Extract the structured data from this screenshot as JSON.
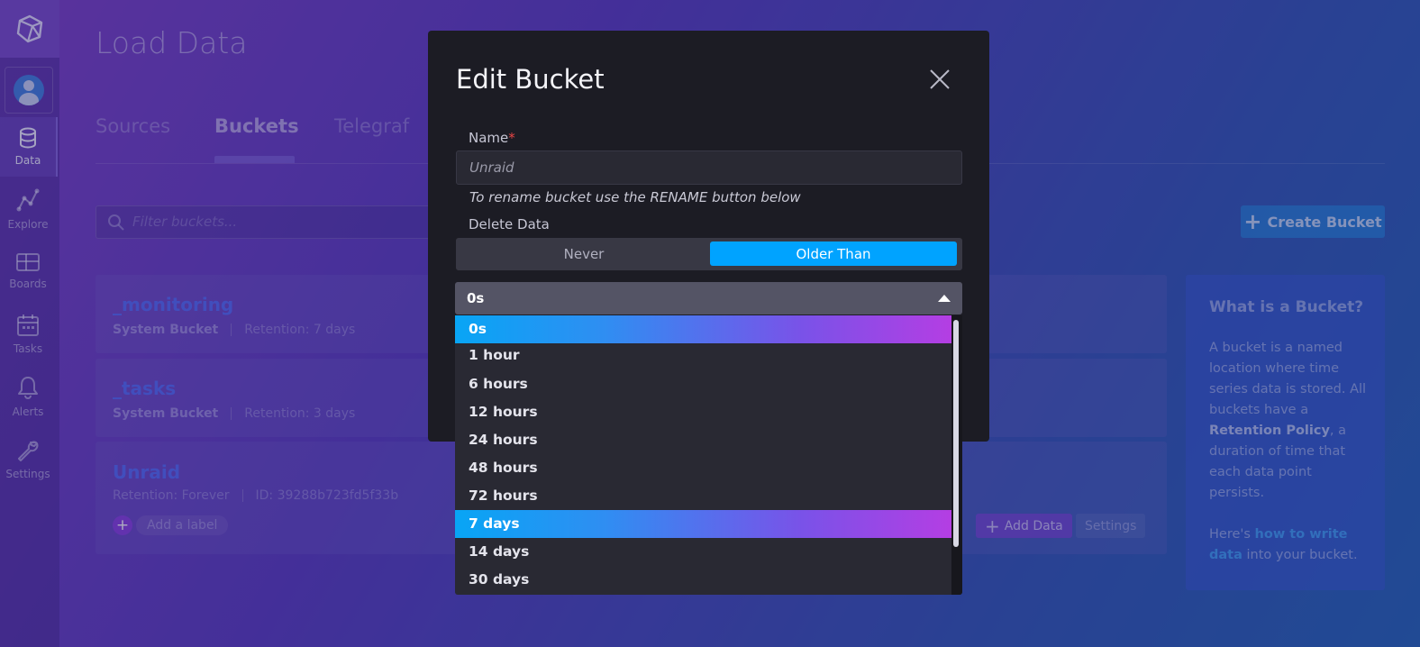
{
  "sidebar": {
    "items": [
      {
        "label": "Data",
        "icon": "database-icon"
      },
      {
        "label": "Explore",
        "icon": "graph-icon"
      },
      {
        "label": "Boards",
        "icon": "dashboard-icon"
      },
      {
        "label": "Tasks",
        "icon": "calendar-icon"
      },
      {
        "label": "Alerts",
        "icon": "bell-icon"
      },
      {
        "label": "Settings",
        "icon": "wrench-icon"
      }
    ]
  },
  "page": {
    "title": "Load Data",
    "tabs": [
      "Sources",
      "Buckets",
      "Telegraf"
    ],
    "active_tab": "Buckets",
    "filter_placeholder": "Filter buckets...",
    "create_button": "Create Bucket"
  },
  "buckets": [
    {
      "name": "_monitoring",
      "type": "System Bucket",
      "retention": "Retention: 7 days"
    },
    {
      "name": "_tasks",
      "type": "System Bucket",
      "retention": "Retention: 3 days"
    },
    {
      "name": "Unraid",
      "retention": "Retention: Forever",
      "id": "ID: 39288b723fd5f33b",
      "add_label": "Add a label",
      "add_data": "Add Data",
      "settings": "Settings"
    }
  ],
  "info_panel": {
    "title": "What is a Bucket?",
    "p1_a": "A bucket is a named location where time series data is stored. All buckets have a ",
    "p1_bold": "Retention Policy",
    "p1_b": ", a duration of time that each data point persists.",
    "p2_a": "Here's ",
    "p2_link": "how to write data",
    "p2_b": " into your bucket."
  },
  "modal": {
    "title": "Edit Bucket",
    "name_label": "Name",
    "required_mark": "*",
    "name_value": "Unraid",
    "rename_hint": "To rename bucket use the RENAME button below",
    "delete_label": "Delete Data",
    "toggle_never": "Never",
    "toggle_older": "Older Than",
    "toggle_selected": "Older Than",
    "dropdown_value": "0s",
    "options": [
      "0s",
      "1 hour",
      "6 hours",
      "12 hours",
      "24 hours",
      "48 hours",
      "72 hours",
      "7 days",
      "14 days",
      "30 days"
    ],
    "highlighted_options": [
      "0s",
      "7 days"
    ]
  },
  "colors": {
    "accent_blue": "#00a3ff",
    "accent_purple": "#b43ee3",
    "modal_bg": "#1c1c24"
  }
}
